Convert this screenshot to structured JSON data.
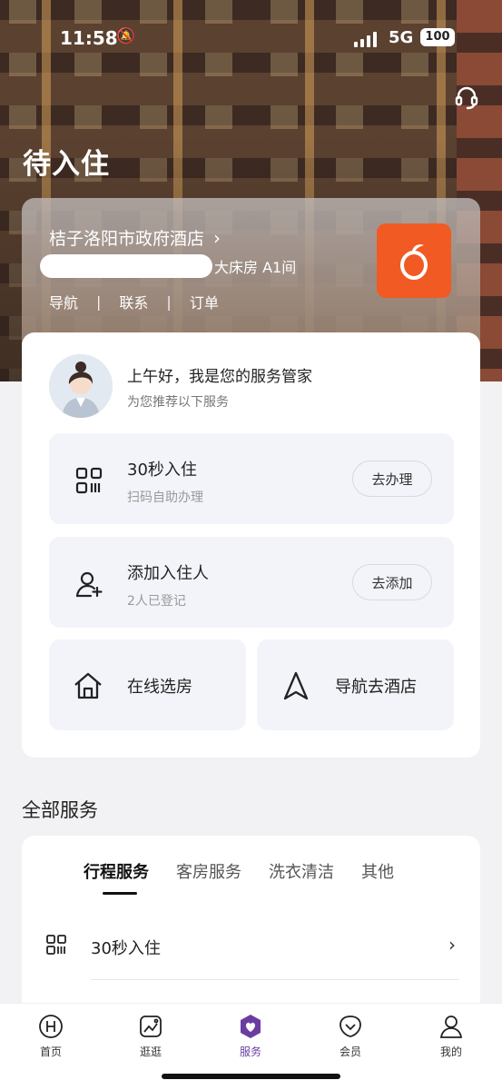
{
  "status": {
    "time": "11:58",
    "network": "5G",
    "battery": "100"
  },
  "header": {
    "title": "待入住"
  },
  "hotel": {
    "name": "桔子洛阳市政府酒店",
    "room": "大床房 A1间",
    "links": [
      "导航",
      "联系",
      "订单"
    ],
    "logo_icon": "orange-logo-icon",
    "logo_color": "#f15a22"
  },
  "steward": {
    "greeting": "上午好，我是您的服务管家",
    "subtitle": "为您推荐以下服务"
  },
  "services": [
    {
      "title": "30秒入住",
      "subtitle": "扫码自助办理",
      "action": "去办理",
      "icon": "qr-code-icon"
    },
    {
      "title": "添加入住人",
      "subtitle": "2人已登记",
      "action": "去添加",
      "icon": "add-user-icon"
    }
  ],
  "quick_actions": [
    {
      "label": "在线选房",
      "icon": "home-icon"
    },
    {
      "label": "导航去酒店",
      "icon": "navigation-icon"
    }
  ],
  "all_services": {
    "title": "全部服务",
    "tabs": [
      "行程服务",
      "客房服务",
      "洗衣清洁",
      "其他"
    ],
    "active_tab": 0,
    "items": [
      {
        "label": "30秒入住",
        "icon": "qr-code-icon"
      }
    ]
  },
  "tabbar": {
    "items": [
      "首页",
      "逛逛",
      "服务",
      "会员",
      "我的"
    ],
    "active": 2,
    "accent": "#6a3ea1"
  }
}
